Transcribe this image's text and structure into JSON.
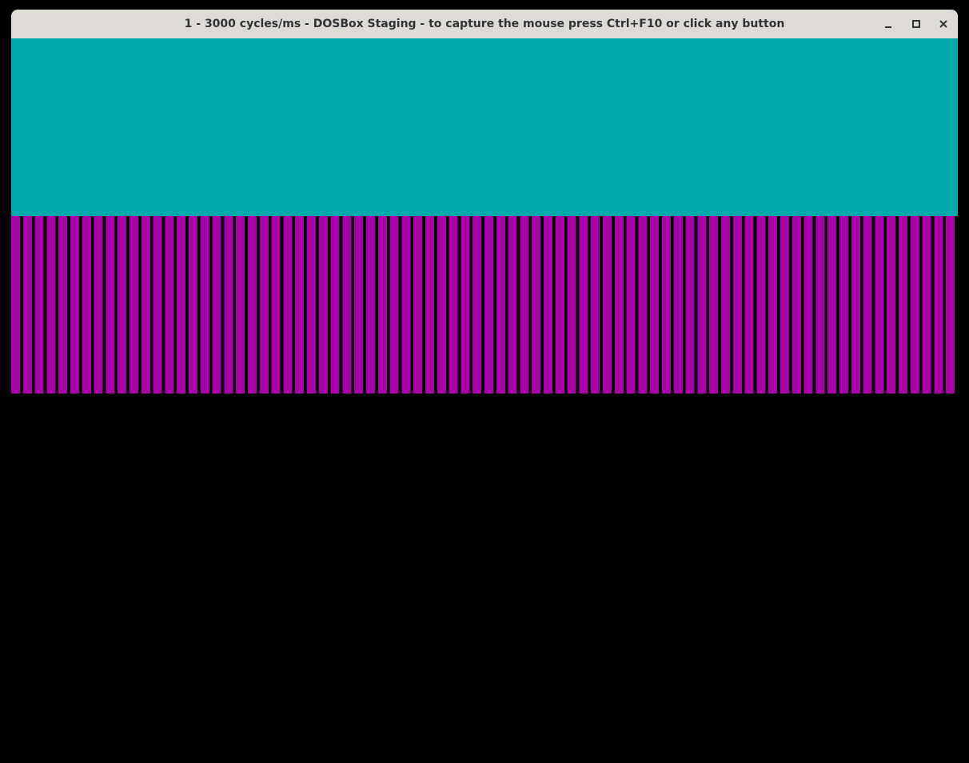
{
  "window": {
    "title": "1 - 3000 cycles/ms - DOSBox Staging - to capture the mouse press Ctrl+F10 or click any button",
    "controls": [
      "minimize-icon",
      "maximize-icon",
      "close-icon"
    ]
  },
  "screen": {
    "top_band_color": "#00aaaa",
    "stripe_color": "#aa00aa",
    "gap_color": "#000000",
    "stripe_count": 80
  }
}
